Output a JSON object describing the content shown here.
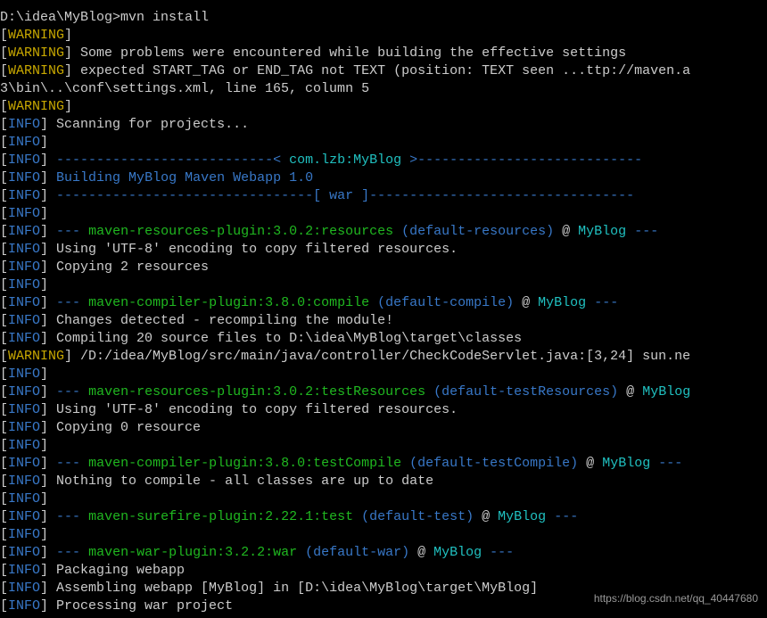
{
  "prompt": "D:\\idea\\MyBlog>",
  "command": "mvn install",
  "lines": [
    {
      "parts": [
        {
          "text": "[",
          "c": "bracket"
        },
        {
          "text": "WARNING",
          "c": "warning"
        },
        {
          "text": "]",
          "c": "bracket"
        }
      ]
    },
    {
      "parts": [
        {
          "text": "[",
          "c": "bracket"
        },
        {
          "text": "WARNING",
          "c": "warning"
        },
        {
          "text": "] Some problems were encountered while building the effective settings",
          "c": "white"
        }
      ]
    },
    {
      "parts": [
        {
          "text": "[",
          "c": "bracket"
        },
        {
          "text": "WARNING",
          "c": "warning"
        },
        {
          "text": "] expected START_TAG or END_TAG not TEXT (position: TEXT seen ...ttp://maven.a",
          "c": "white"
        }
      ]
    },
    {
      "parts": [
        {
          "text": "3\\bin\\..\\conf\\settings.xml, line 165, column 5",
          "c": "white"
        }
      ]
    },
    {
      "parts": [
        {
          "text": "[",
          "c": "bracket"
        },
        {
          "text": "WARNING",
          "c": "warning"
        },
        {
          "text": "]",
          "c": "bracket"
        }
      ]
    },
    {
      "parts": [
        {
          "text": "[",
          "c": "bracket"
        },
        {
          "text": "INFO",
          "c": "info"
        },
        {
          "text": "] Scanning for projects...",
          "c": "white"
        }
      ]
    },
    {
      "parts": [
        {
          "text": "[",
          "c": "bracket"
        },
        {
          "text": "INFO",
          "c": "info"
        },
        {
          "text": "]",
          "c": "bracket"
        }
      ]
    },
    {
      "parts": [
        {
          "text": "[",
          "c": "bracket"
        },
        {
          "text": "INFO",
          "c": "info"
        },
        {
          "text": "] ",
          "c": "white"
        },
        {
          "text": "---------------------------< ",
          "c": "info"
        },
        {
          "text": "com.lzb:MyBlog",
          "c": "cyan"
        },
        {
          "text": " >----------------------------",
          "c": "info"
        }
      ]
    },
    {
      "parts": [
        {
          "text": "[",
          "c": "bracket"
        },
        {
          "text": "INFO",
          "c": "info"
        },
        {
          "text": "] ",
          "c": "white"
        },
        {
          "text": "Building MyBlog Maven Webapp 1.0",
          "c": "info"
        }
      ]
    },
    {
      "parts": [
        {
          "text": "[",
          "c": "bracket"
        },
        {
          "text": "INFO",
          "c": "info"
        },
        {
          "text": "] ",
          "c": "white"
        },
        {
          "text": "--------------------------------[ war ]---------------------------------",
          "c": "info"
        }
      ]
    },
    {
      "parts": [
        {
          "text": "[",
          "c": "bracket"
        },
        {
          "text": "INFO",
          "c": "info"
        },
        {
          "text": "]",
          "c": "bracket"
        }
      ]
    },
    {
      "parts": [
        {
          "text": "[",
          "c": "bracket"
        },
        {
          "text": "INFO",
          "c": "info"
        },
        {
          "text": "] ",
          "c": "white"
        },
        {
          "text": "--- ",
          "c": "info"
        },
        {
          "text": "maven-resources-plugin:3.0.2:resources",
          "c": "green"
        },
        {
          "text": " (default-resources)",
          "c": "info"
        },
        {
          "text": " @ ",
          "c": "white"
        },
        {
          "text": "MyBlog",
          "c": "cyan"
        },
        {
          "text": " ---",
          "c": "info"
        }
      ]
    },
    {
      "parts": [
        {
          "text": "[",
          "c": "bracket"
        },
        {
          "text": "INFO",
          "c": "info"
        },
        {
          "text": "] Using 'UTF-8' encoding to copy filtered resources.",
          "c": "white"
        }
      ]
    },
    {
      "parts": [
        {
          "text": "[",
          "c": "bracket"
        },
        {
          "text": "INFO",
          "c": "info"
        },
        {
          "text": "] Copying 2 resources",
          "c": "white"
        }
      ]
    },
    {
      "parts": [
        {
          "text": "[",
          "c": "bracket"
        },
        {
          "text": "INFO",
          "c": "info"
        },
        {
          "text": "]",
          "c": "bracket"
        }
      ]
    },
    {
      "parts": [
        {
          "text": "[",
          "c": "bracket"
        },
        {
          "text": "INFO",
          "c": "info"
        },
        {
          "text": "] ",
          "c": "white"
        },
        {
          "text": "--- ",
          "c": "info"
        },
        {
          "text": "maven-compiler-plugin:3.8.0:compile",
          "c": "green"
        },
        {
          "text": " (default-compile)",
          "c": "info"
        },
        {
          "text": " @ ",
          "c": "white"
        },
        {
          "text": "MyBlog",
          "c": "cyan"
        },
        {
          "text": " ---",
          "c": "info"
        }
      ]
    },
    {
      "parts": [
        {
          "text": "[",
          "c": "bracket"
        },
        {
          "text": "INFO",
          "c": "info"
        },
        {
          "text": "] Changes detected - recompiling the module!",
          "c": "white"
        }
      ]
    },
    {
      "parts": [
        {
          "text": "[",
          "c": "bracket"
        },
        {
          "text": "INFO",
          "c": "info"
        },
        {
          "text": "] Compiling 20 source files to D:\\idea\\MyBlog\\target\\classes",
          "c": "white"
        }
      ]
    },
    {
      "parts": [
        {
          "text": "[",
          "c": "bracket"
        },
        {
          "text": "WARNING",
          "c": "warning"
        },
        {
          "text": "] /D:/idea/MyBlog/src/main/java/controller/CheckCodeServlet.java:[3,24] sun.ne",
          "c": "white"
        }
      ]
    },
    {
      "parts": [
        {
          "text": "[",
          "c": "bracket"
        },
        {
          "text": "INFO",
          "c": "info"
        },
        {
          "text": "]",
          "c": "bracket"
        }
      ]
    },
    {
      "parts": [
        {
          "text": "[",
          "c": "bracket"
        },
        {
          "text": "INFO",
          "c": "info"
        },
        {
          "text": "] ",
          "c": "white"
        },
        {
          "text": "--- ",
          "c": "info"
        },
        {
          "text": "maven-resources-plugin:3.0.2:testResources",
          "c": "green"
        },
        {
          "text": " (default-testResources)",
          "c": "info"
        },
        {
          "text": " @ ",
          "c": "white"
        },
        {
          "text": "MyBlog",
          "c": "cyan"
        }
      ]
    },
    {
      "parts": [
        {
          "text": "[",
          "c": "bracket"
        },
        {
          "text": "INFO",
          "c": "info"
        },
        {
          "text": "] Using 'UTF-8' encoding to copy filtered resources.",
          "c": "white"
        }
      ]
    },
    {
      "parts": [
        {
          "text": "[",
          "c": "bracket"
        },
        {
          "text": "INFO",
          "c": "info"
        },
        {
          "text": "] Copying 0 resource",
          "c": "white"
        }
      ]
    },
    {
      "parts": [
        {
          "text": "[",
          "c": "bracket"
        },
        {
          "text": "INFO",
          "c": "info"
        },
        {
          "text": "]",
          "c": "bracket"
        }
      ]
    },
    {
      "parts": [
        {
          "text": "[",
          "c": "bracket"
        },
        {
          "text": "INFO",
          "c": "info"
        },
        {
          "text": "] ",
          "c": "white"
        },
        {
          "text": "--- ",
          "c": "info"
        },
        {
          "text": "maven-compiler-plugin:3.8.0:testCompile",
          "c": "green"
        },
        {
          "text": " (default-testCompile)",
          "c": "info"
        },
        {
          "text": " @ ",
          "c": "white"
        },
        {
          "text": "MyBlog",
          "c": "cyan"
        },
        {
          "text": " ---",
          "c": "info"
        }
      ]
    },
    {
      "parts": [
        {
          "text": "[",
          "c": "bracket"
        },
        {
          "text": "INFO",
          "c": "info"
        },
        {
          "text": "] Nothing to compile - all classes are up to date",
          "c": "white"
        }
      ]
    },
    {
      "parts": [
        {
          "text": "[",
          "c": "bracket"
        },
        {
          "text": "INFO",
          "c": "info"
        },
        {
          "text": "]",
          "c": "bracket"
        }
      ]
    },
    {
      "parts": [
        {
          "text": "[",
          "c": "bracket"
        },
        {
          "text": "INFO",
          "c": "info"
        },
        {
          "text": "] ",
          "c": "white"
        },
        {
          "text": "--- ",
          "c": "info"
        },
        {
          "text": "maven-surefire-plugin:2.22.1:test",
          "c": "green"
        },
        {
          "text": " (default-test)",
          "c": "info"
        },
        {
          "text": " @ ",
          "c": "white"
        },
        {
          "text": "MyBlog",
          "c": "cyan"
        },
        {
          "text": " ---",
          "c": "info"
        }
      ]
    },
    {
      "parts": [
        {
          "text": "[",
          "c": "bracket"
        },
        {
          "text": "INFO",
          "c": "info"
        },
        {
          "text": "]",
          "c": "bracket"
        }
      ]
    },
    {
      "parts": [
        {
          "text": "[",
          "c": "bracket"
        },
        {
          "text": "INFO",
          "c": "info"
        },
        {
          "text": "] ",
          "c": "white"
        },
        {
          "text": "--- ",
          "c": "info"
        },
        {
          "text": "maven-war-plugin:3.2.2:war",
          "c": "green"
        },
        {
          "text": " (default-war)",
          "c": "info"
        },
        {
          "text": " @ ",
          "c": "white"
        },
        {
          "text": "MyBlog",
          "c": "cyan"
        },
        {
          "text": " ---",
          "c": "info"
        }
      ]
    },
    {
      "parts": [
        {
          "text": "[",
          "c": "bracket"
        },
        {
          "text": "INFO",
          "c": "info"
        },
        {
          "text": "] Packaging webapp",
          "c": "white"
        }
      ]
    },
    {
      "parts": [
        {
          "text": "[",
          "c": "bracket"
        },
        {
          "text": "INFO",
          "c": "info"
        },
        {
          "text": "] Assembling webapp [MyBlog] in [D:\\idea\\MyBlog\\target\\MyBlog]",
          "c": "white"
        }
      ]
    },
    {
      "parts": [
        {
          "text": "[",
          "c": "bracket"
        },
        {
          "text": "INFO",
          "c": "info"
        },
        {
          "text": "] Processing war project",
          "c": "white"
        }
      ]
    }
  ],
  "watermark": "https://blog.csdn.net/qq_40447680"
}
